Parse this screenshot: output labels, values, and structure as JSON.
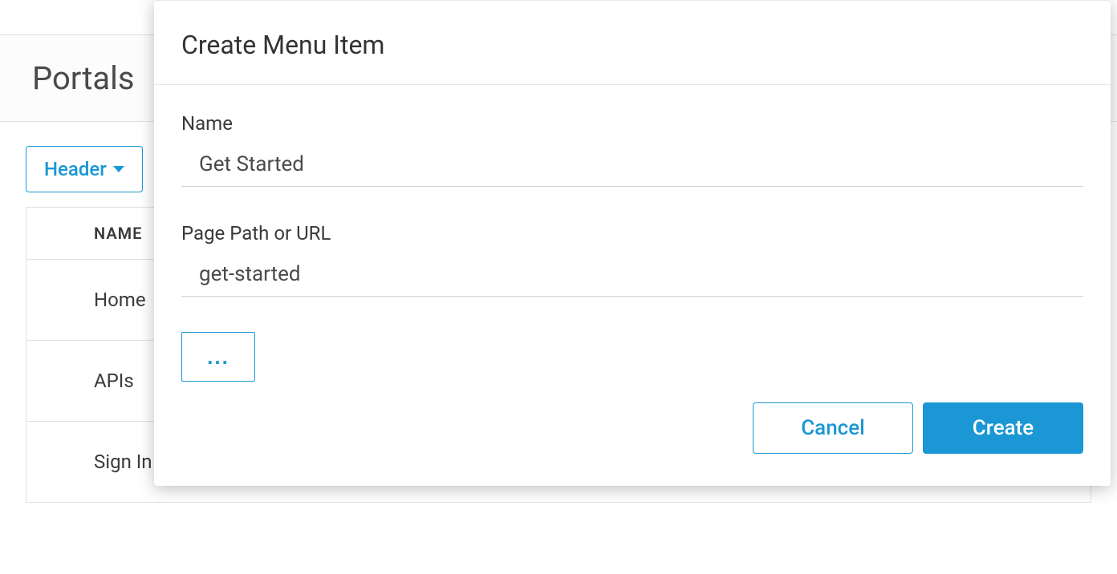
{
  "page": {
    "title": "Portals"
  },
  "toolbar": {
    "dropdown_label": "Header"
  },
  "table": {
    "column_name": "NAME",
    "rows": [
      {
        "name": "Home"
      },
      {
        "name": "APIs"
      },
      {
        "name": "Sign In"
      }
    ]
  },
  "modal": {
    "title": "Create Menu Item",
    "name_label": "Name",
    "name_value": "Get Started",
    "path_label": "Page Path or URL",
    "path_value": "get-started",
    "more_label": "...",
    "cancel_label": "Cancel",
    "create_label": "Create"
  }
}
